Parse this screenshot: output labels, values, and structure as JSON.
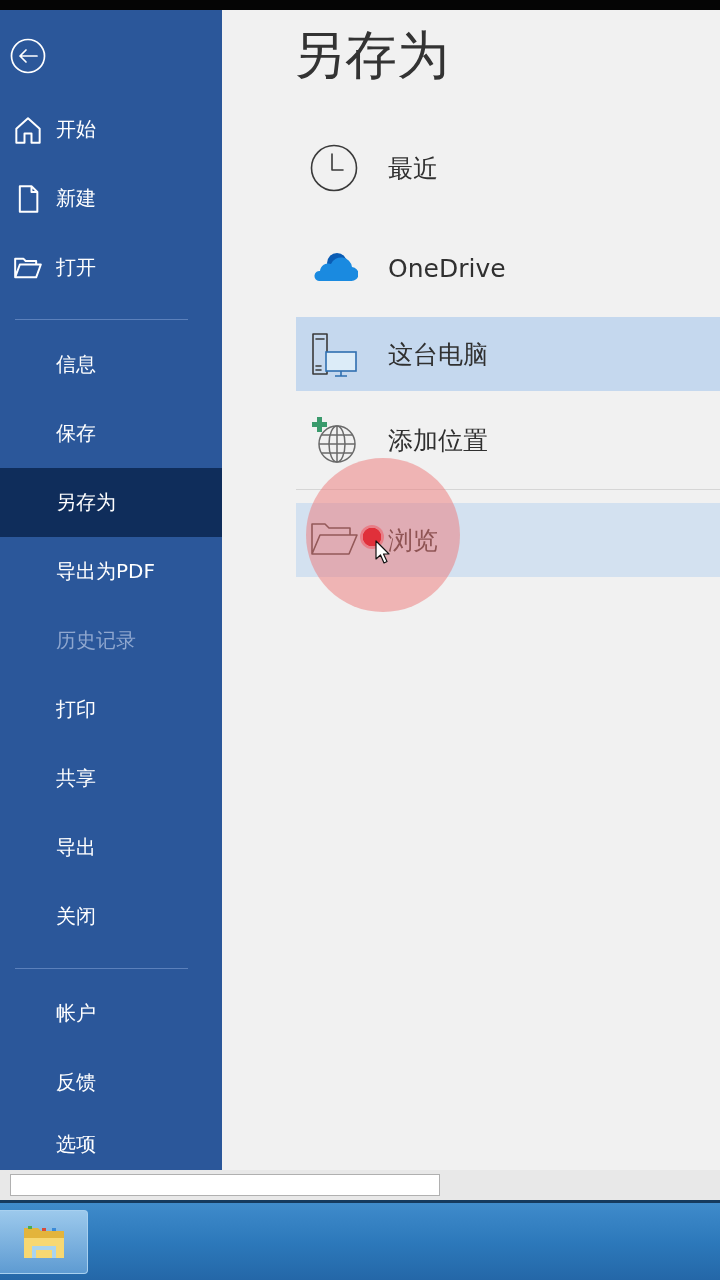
{
  "sidebar": {
    "groups": [
      {
        "items": [
          {
            "label": "开始",
            "kind": "home",
            "selected": false,
            "disabled": false
          },
          {
            "label": "新建",
            "kind": "new",
            "selected": false,
            "disabled": false
          },
          {
            "label": "打开",
            "kind": "open",
            "selected": false,
            "disabled": false
          }
        ]
      },
      {
        "items": [
          {
            "label": "信息",
            "kind": "plain",
            "selected": false,
            "disabled": false
          },
          {
            "label": "保存",
            "kind": "plain",
            "selected": false,
            "disabled": false
          },
          {
            "label": "另存为",
            "kind": "plain",
            "selected": true,
            "disabled": false
          },
          {
            "label": "导出为PDF",
            "kind": "plain",
            "selected": false,
            "disabled": false
          },
          {
            "label": "历史记录",
            "kind": "plain",
            "selected": false,
            "disabled": true
          },
          {
            "label": "打印",
            "kind": "plain",
            "selected": false,
            "disabled": false
          },
          {
            "label": "共享",
            "kind": "plain",
            "selected": false,
            "disabled": false
          },
          {
            "label": "导出",
            "kind": "plain",
            "selected": false,
            "disabled": false
          },
          {
            "label": "关闭",
            "kind": "plain",
            "selected": false,
            "disabled": false
          }
        ]
      },
      {
        "items": [
          {
            "label": "帐户",
            "kind": "plain",
            "selected": false,
            "disabled": false
          },
          {
            "label": "反馈",
            "kind": "plain",
            "selected": false,
            "disabled": false
          },
          {
            "label": "选项",
            "kind": "plain",
            "selected": false,
            "disabled": false
          }
        ]
      }
    ]
  },
  "page": {
    "title": "另存为",
    "location_groups": [
      {
        "items": [
          {
            "label": "最近",
            "kind": "recent",
            "selected": false,
            "hovered": false
          },
          {
            "label": "OneDrive",
            "kind": "onedrive",
            "selected": false,
            "hovered": false
          },
          {
            "label": "这台电脑",
            "kind": "pc",
            "selected": true,
            "hovered": false
          },
          {
            "label": "添加位置",
            "kind": "addplace",
            "selected": false,
            "hovered": false
          }
        ]
      },
      {
        "items": [
          {
            "label": "浏览",
            "kind": "browse",
            "selected": false,
            "hovered": true
          }
        ]
      }
    ]
  }
}
